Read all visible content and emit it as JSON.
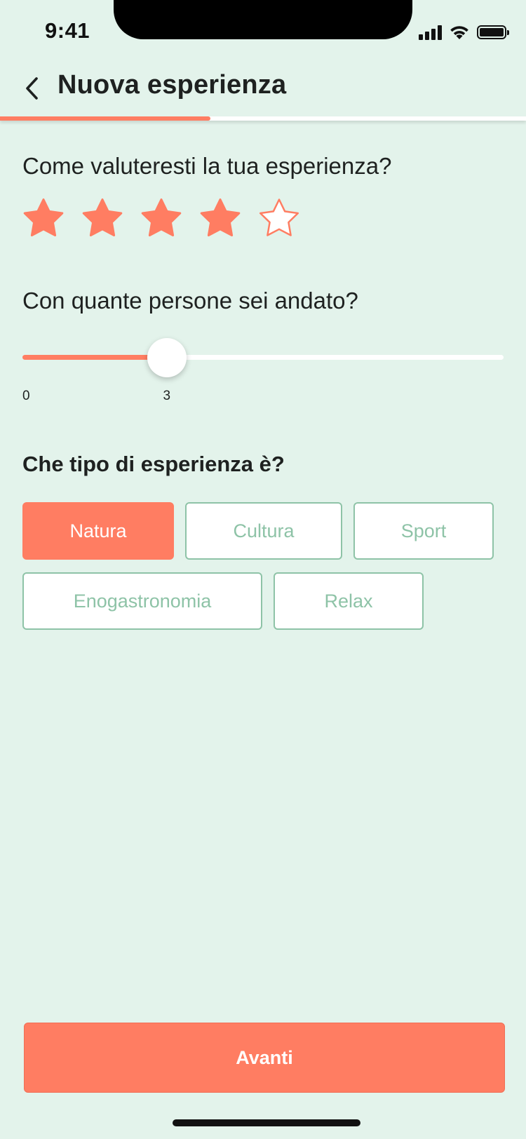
{
  "status_bar": {
    "time": "9:41",
    "icons": [
      "cellular-signal-icon",
      "wifi-icon",
      "battery-icon"
    ]
  },
  "header": {
    "back_icon": "chevron-left-icon",
    "title": "Nuova esperienza",
    "progress": 0.4
  },
  "rating": {
    "question": "Come valuteresti la tua esperienza?",
    "value": 4,
    "max": 5
  },
  "people": {
    "question": "Con quante persone sei andato?",
    "min_label": "0",
    "value_label": "3",
    "value": 3,
    "slider_fraction": 0.3
  },
  "type": {
    "question": "Che tipo di esperienza è?",
    "options": [
      {
        "label": "Natura",
        "selected": true
      },
      {
        "label": "Cultura",
        "selected": false
      },
      {
        "label": "Sport",
        "selected": false
      },
      {
        "label": "Enogastronomia",
        "selected": false
      },
      {
        "label": "Relax",
        "selected": false
      }
    ]
  },
  "cta": {
    "label": "Avanti"
  },
  "colors": {
    "background": "#E3F3EB",
    "accent": "#FF7D62",
    "chip_border": "#8EC3A7",
    "text": "#1E2120"
  }
}
